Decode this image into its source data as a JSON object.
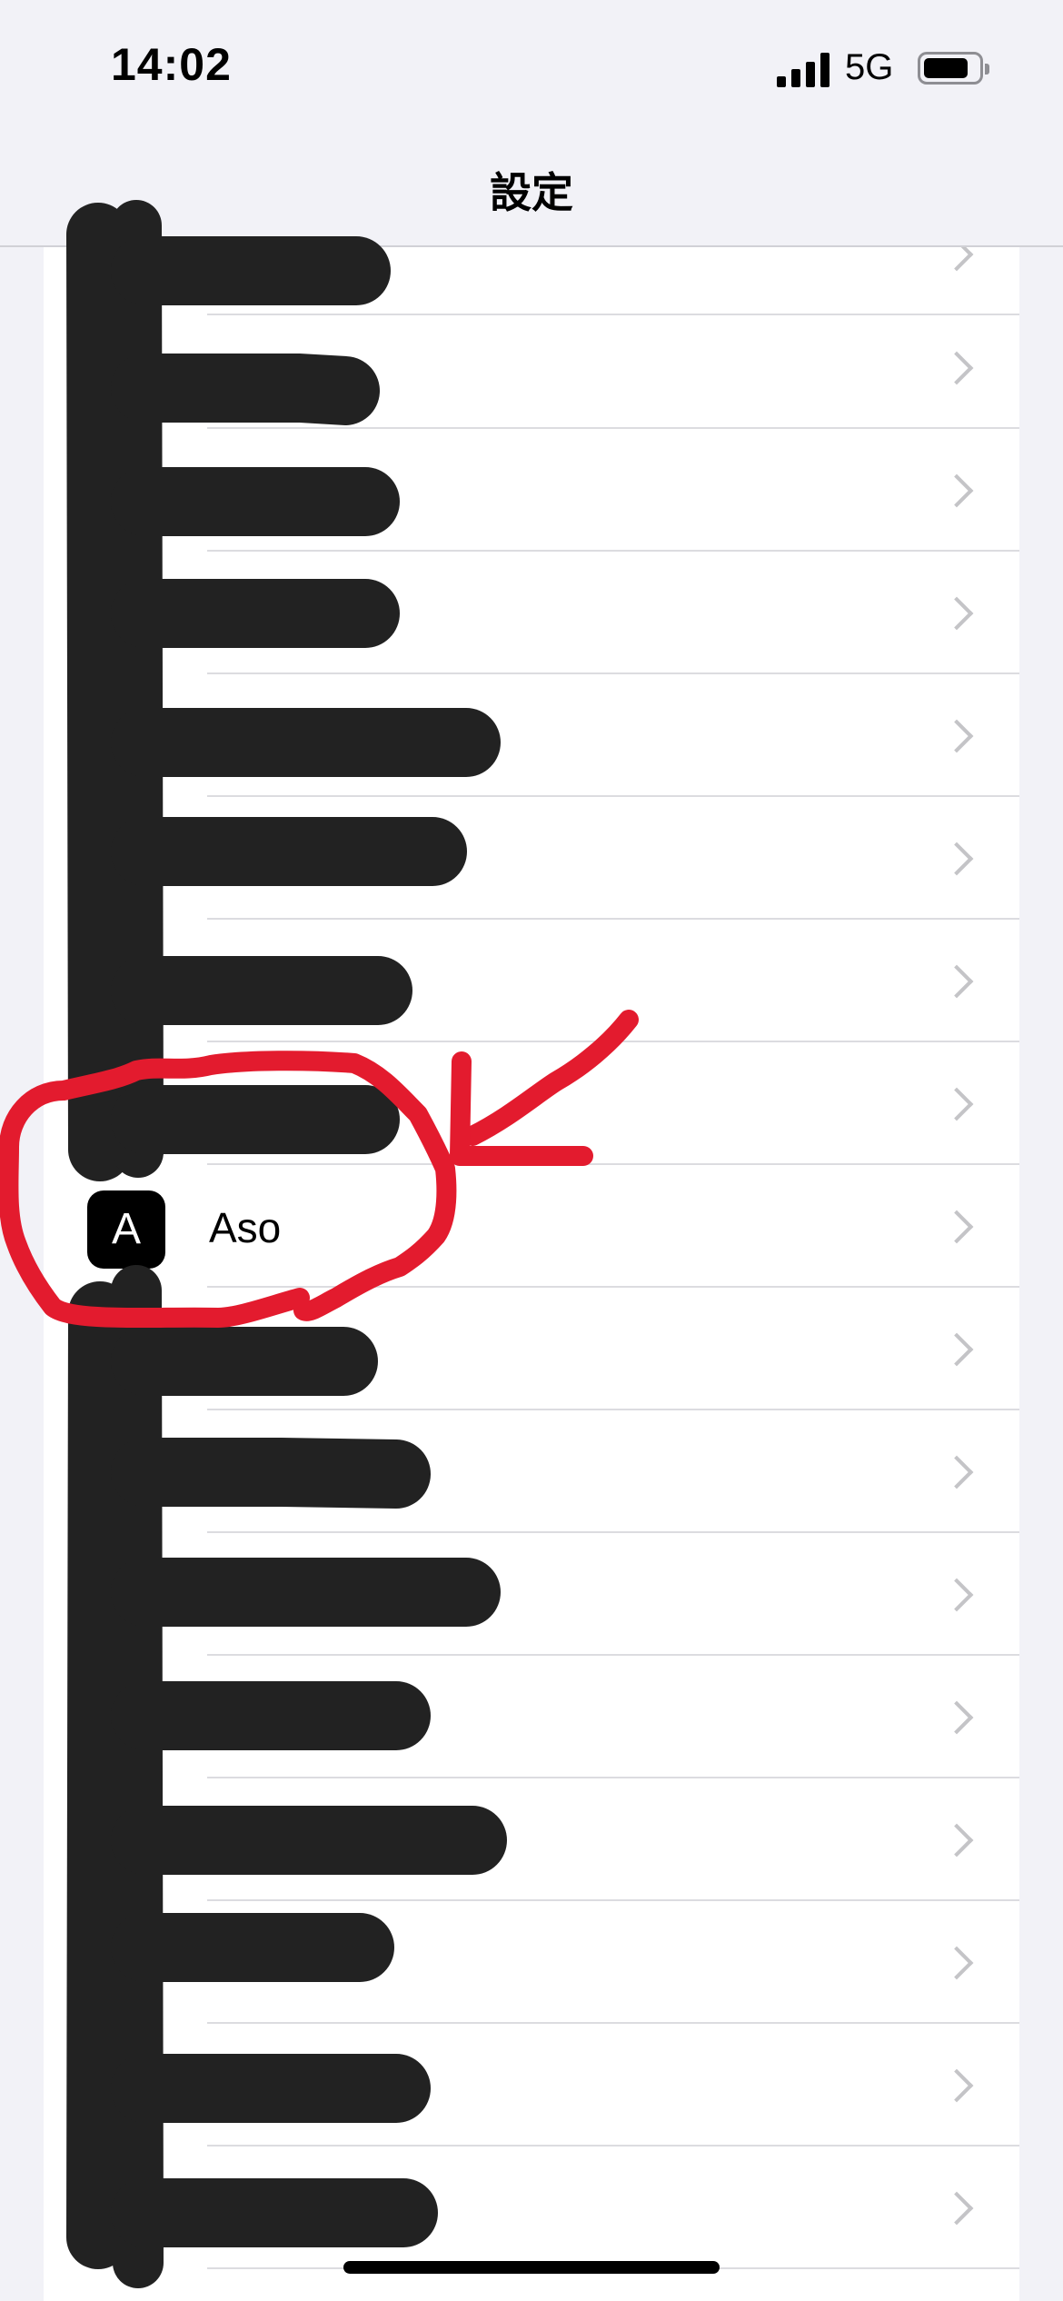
{
  "status_bar": {
    "time": "14:02",
    "network": "5G",
    "icons": [
      "signal-icon",
      "battery-icon"
    ]
  },
  "nav": {
    "title": "設定"
  },
  "list": {
    "highlighted_app": {
      "icon_letter": "A",
      "label": "Aso"
    },
    "row_chevron_icon": "chevron-right-icon"
  },
  "colors": {
    "annotation_red": "#e31b2e",
    "redaction_black": "#222222",
    "chevron_gray": "#c4c4c7"
  }
}
